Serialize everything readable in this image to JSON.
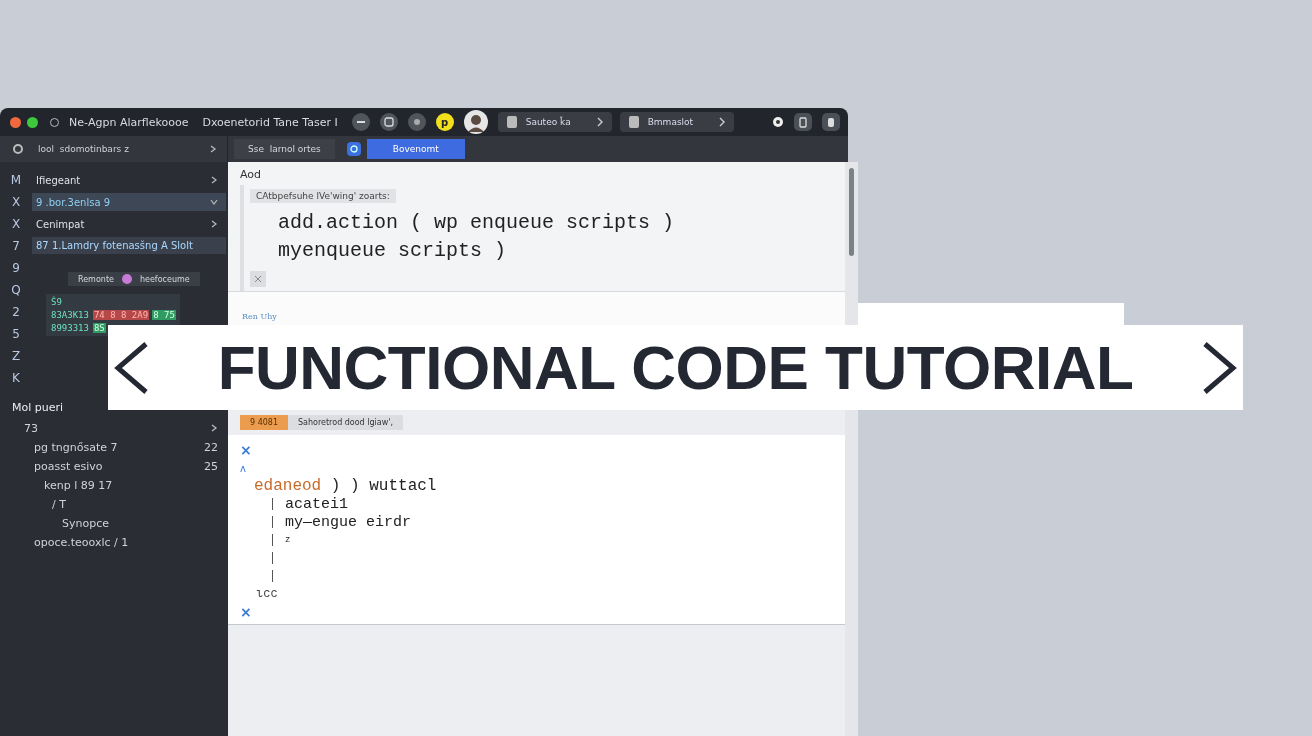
{
  "window": {
    "title_parts": [
      "Ne‑Agpn Alarflekoooe",
      "Dxoenetorid Tane Taser I"
    ]
  },
  "title_bar": {
    "badge": "p",
    "breadcrumbs": [
      {
        "label": "Sauteo ǩa"
      },
      {
        "label": "Bmmaslot"
      }
    ]
  },
  "toolbar": {
    "sidebar_header": "lool  sdomotinbars z",
    "tabs": [
      {
        "label": "Sse  larnol ortes",
        "selected": false
      },
      {
        "label": "Bovenomt",
        "selected": true
      }
    ]
  },
  "sidebar": {
    "gutter": [
      "M",
      "X",
      "X",
      "7",
      "9",
      "Q",
      "2",
      "5",
      "Z",
      "K"
    ],
    "items": [
      {
        "label": "Ifiegeant",
        "expanded": false,
        "selected": false
      },
      {
        "label": "9 .bor.3enlsa 9",
        "expanded": true,
        "selected": true
      },
      {
        "label": "Cenimpat",
        "expanded": false,
        "selected": false
      }
    ],
    "highlight": "87 1.Lamdry fotenasšng A Slolt",
    "chip": {
      "label": "Remonte",
      "tag": "heefoceume",
      "color": "#c77bd6"
    },
    "snippet": [
      [
        {
          "text": "Ŝ9",
          "kind": "plain"
        }
      ],
      [
        {
          "text": "83A3K13",
          "kind": "plain"
        },
        {
          "text": "74 8 8 2A9",
          "kind": "error"
        },
        {
          "text": "8 75",
          "kind": "ok"
        }
      ],
      [
        {
          "text": "8993313",
          "kind": "plain"
        },
        {
          "text": "8S",
          "kind": "ok"
        }
      ]
    ],
    "section": {
      "title": "Mol pueri",
      "tree": [
        {
          "label": "73",
          "children": [
            {
              "label": "pg tngnősate 7",
              "count": "22"
            },
            {
              "label": "poasst esivo",
              "count": "25",
              "children": [
                {
                  "label": "kenp l 89 17",
                  "children": [
                    {
                      "label": "/ T",
                      "children": [
                        {
                          "label": "Synopce"
                        }
                      ]
                    }
                  ]
                }
              ]
            },
            {
              "label": "opoce.teooxlc / 1"
            }
          ]
        }
      ]
    }
  },
  "editor": {
    "label": "Aod",
    "caption": "CAtbpefsuhe lVe'wing' zoarts:",
    "code": [
      "add.action ( wp enqueue scripts )",
      "myenqueue scripts )"
    ],
    "link": "Ren Uhy"
  },
  "banner": {
    "title": "FUNCTIONAL CODE TUTORIAL"
  },
  "lower_tabs": [
    {
      "label": "9 4081",
      "selected": true
    },
    {
      "label": "Sahoretrod dood lgiaw',",
      "selected": false
    }
  ],
  "lower_code": [
    {
      "kind": "mark",
      "text": "×"
    },
    {
      "kind": "note",
      "text": "ʌ"
    },
    {
      "kind": "head",
      "keyword": "edaneod",
      "text": " ) ) wuttacl"
    },
    {
      "kind": "code",
      "text": "acatei1"
    },
    {
      "kind": "code",
      "text": "my—engue eirdr"
    },
    {
      "kind": "code",
      "text": "z"
    },
    {
      "kind": "bar"
    },
    {
      "kind": "bar"
    },
    {
      "kind": "end",
      "text": "ιcc"
    },
    {
      "kind": "mark",
      "text": "×"
    }
  ]
}
